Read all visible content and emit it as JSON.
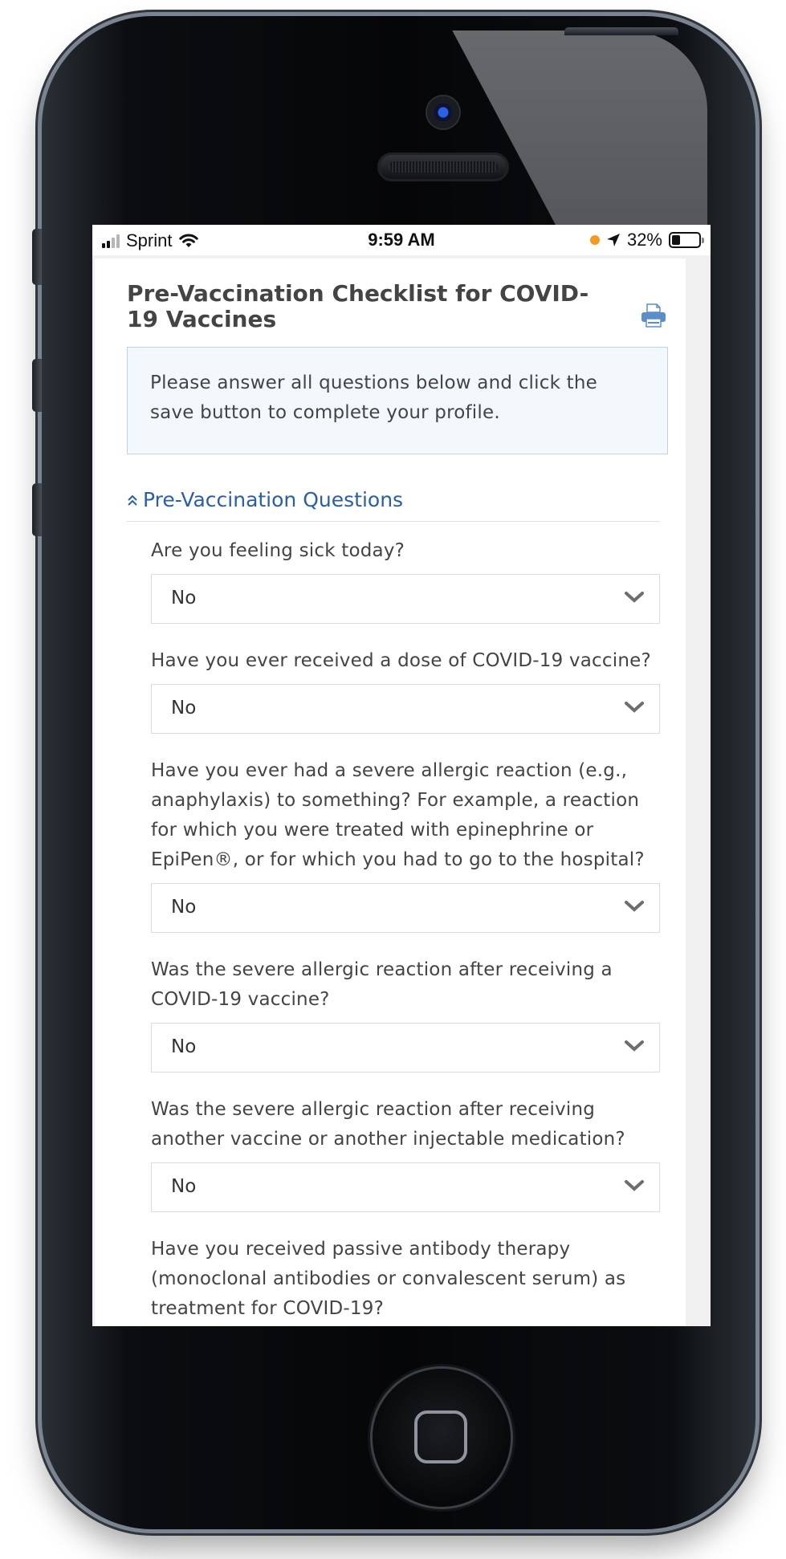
{
  "status_bar": {
    "carrier": "Sprint",
    "time": "9:59 AM",
    "battery": "32%",
    "battery_level": 0.32
  },
  "page": {
    "title": "Pre-Vaccination Checklist for COVID-19 Vaccines",
    "info": "Please answer all questions below and click the save button to complete your profile.",
    "section_title": "Pre-Vaccination Questions"
  },
  "questions": [
    {
      "label": "Are you feeling sick today?",
      "value": "No"
    },
    {
      "label": "Have you ever received a dose of COVID-19 vaccine?",
      "value": "No"
    },
    {
      "label": "Have you ever had a severe allergic reaction (e.g., anaphylaxis) to something? For example, a reaction for which you were treated with epinephrine or EpiPen®, or for which you had to go to the hospital?",
      "value": "No"
    },
    {
      "label": "Was the severe allergic reaction after receiving a COVID-19 vaccine?",
      "value": "No"
    },
    {
      "label": "Was the severe allergic reaction after receiving another vaccine or another injectable medication?",
      "value": "No"
    },
    {
      "label": "Have you received passive antibody therapy (monoclonal antibodies or convalescent serum) as treatment for COVID-19?"
    }
  ],
  "colors": {
    "link": "#2a5ea8",
    "info_border": "#bcd3ea",
    "info_bg": "#f3f8fd",
    "text": "#444444",
    "print_icon": "#5b8ec7"
  }
}
